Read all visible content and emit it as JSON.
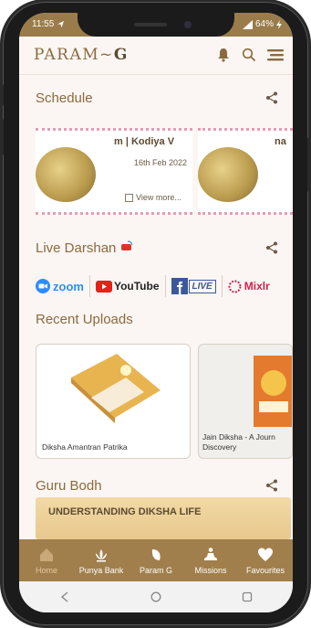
{
  "status": {
    "time": "11:55",
    "battery": "64%"
  },
  "app": {
    "brand_prefix": "PARAM~",
    "brand_suffix": "G"
  },
  "sections": {
    "schedule": "Schedule",
    "live": "Live Darshan",
    "uploads": "Recent Uploads",
    "guru": "Guru Bodh"
  },
  "schedule_cards": [
    {
      "title": "m | Kodiya V",
      "date": "16th Feb 2022",
      "more": "View more..."
    },
    {
      "title": "na"
    }
  ],
  "live_platforms": [
    "zoom",
    "YouTube",
    "LIVE",
    "Mixlr"
  ],
  "uploads": [
    {
      "caption": "Diksha Amantran Patrika"
    },
    {
      "caption_line1": "Jain Diksha - A Journ",
      "caption_line2": "Discovery"
    }
  ],
  "guru_banner": "UNDERSTANDING DIKSHA LIFE",
  "nav": [
    {
      "label": "Home",
      "icon": "home-icon",
      "active": true
    },
    {
      "label": "Punya Bank",
      "icon": "lotus-icon"
    },
    {
      "label": "Param G",
      "icon": "leaf-icon"
    },
    {
      "label": "Missions",
      "icon": "meditation-icon"
    },
    {
      "label": "Favourites",
      "icon": "heart-icon"
    }
  ],
  "colors": {
    "accent": "#a07f4c",
    "brand": "#8a6a3e",
    "background": "#fbf6f3"
  }
}
